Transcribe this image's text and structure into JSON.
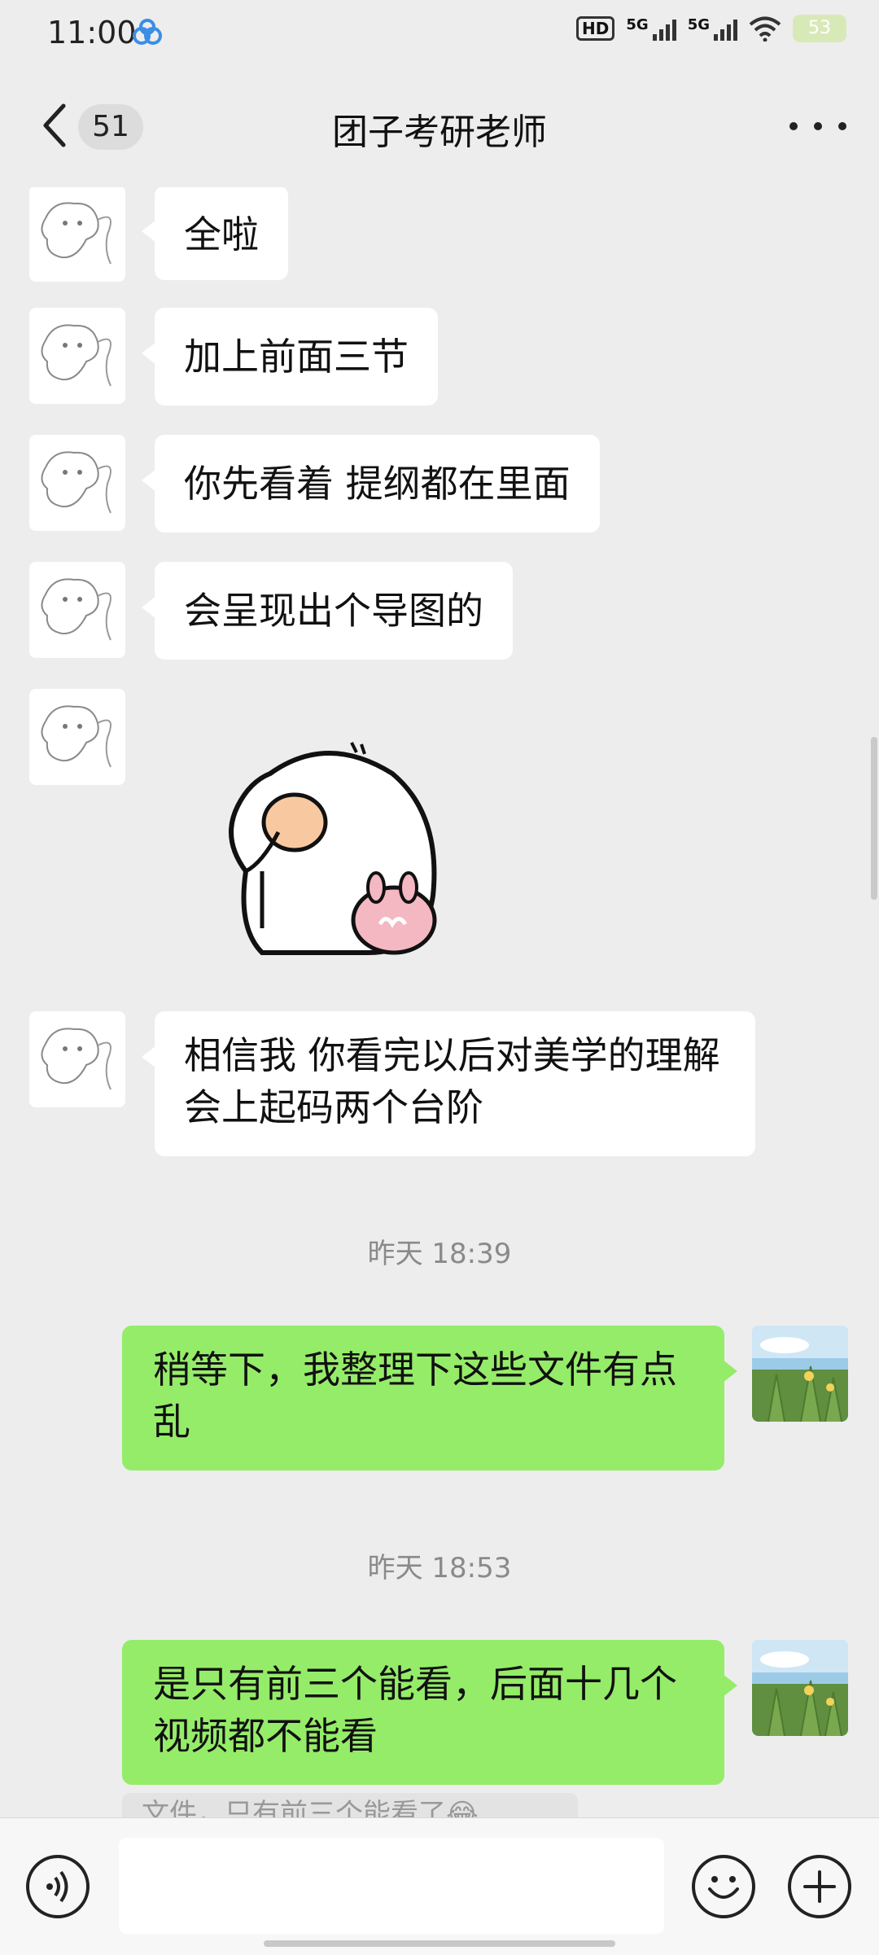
{
  "status_bar": {
    "time": "11:00",
    "hd": "HD",
    "sig1": "5G",
    "sig2": "5G",
    "battery": "53"
  },
  "nav": {
    "unread_count": "51",
    "title": "团子考研老师",
    "back_icon": "chevron-left-icon",
    "more_icon": "more-dots-icon"
  },
  "messages": [
    {
      "side": "left",
      "text": "全啦"
    },
    {
      "side": "left",
      "text": "加上前面三节"
    },
    {
      "side": "left",
      "text": "你先看着 提纲都在里面"
    },
    {
      "side": "left",
      "text": "会呈现出个导图的"
    },
    {
      "side": "left",
      "type": "sticker",
      "sticker": "round-bird-sticker"
    },
    {
      "side": "left",
      "text": "相信我 你看完以后对美学的理解会上起码两个台阶"
    },
    {
      "type": "timestamp",
      "text": "昨天 18:39"
    },
    {
      "side": "right",
      "text": "稍等下，我整理下这些文件有点乱"
    },
    {
      "type": "timestamp",
      "text": "昨天 18:53"
    },
    {
      "side": "right",
      "text": "是只有前三个能看，后面十几个视频都不能看"
    }
  ],
  "quote_preview": "文件，只有前三个能看了😂",
  "input": {
    "placeholder": ""
  },
  "icons": {
    "voice": "voice-icon",
    "emoji": "emoji-icon",
    "plus": "plus-icon"
  },
  "colors": {
    "background": "#ededed",
    "incoming_bubble": "#ffffff",
    "outgoing_bubble": "#95ec69"
  }
}
